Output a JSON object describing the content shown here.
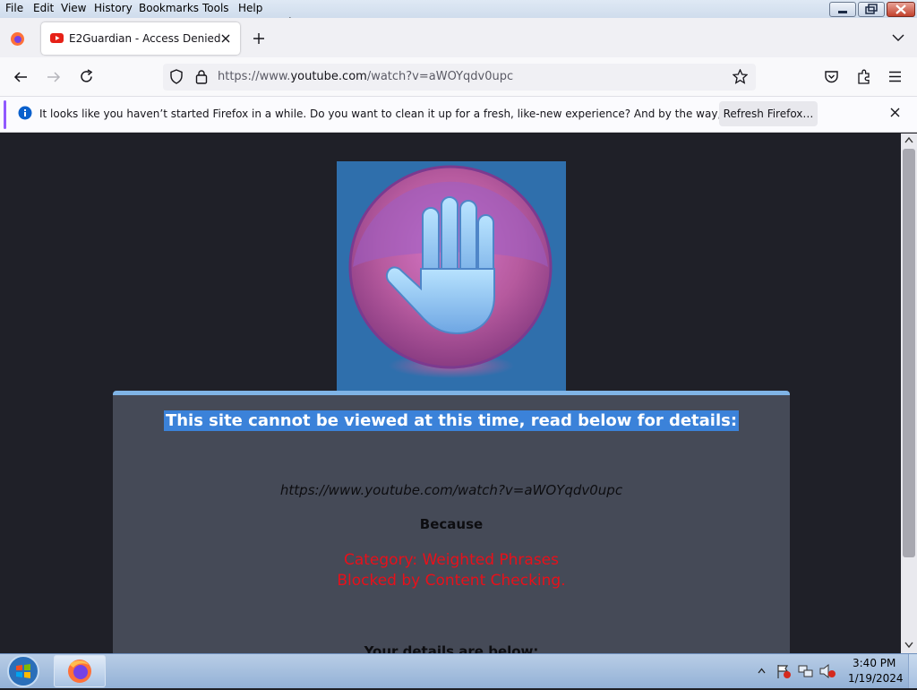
{
  "menu": {
    "file": "File",
    "edit": "Edit",
    "view": "View",
    "history": "History",
    "bookmarks": "Bookmarks",
    "tools": "Tools",
    "help": "Help"
  },
  "tab": {
    "title": "E2Guardian - Access Denied",
    "icon": "youtube-icon"
  },
  "address": {
    "prefix": "https://www.",
    "domain": "youtube.com",
    "path": "/watch?v=aWOYqdv0upc"
  },
  "notification": {
    "message": "It looks like you haven’t started Firefox in a while. Do you want to clean it up for a fresh, like-new experience? And by the way, welcome back!",
    "button": "Refresh Firefox…"
  },
  "page": {
    "headline": "This site cannot be viewed at this time, read below for details:",
    "blocked_url": "https://www.youtube.com/watch?v=aWOYqdv0upc",
    "because": "Because",
    "reason_line1": "Category: Weighted Phrases",
    "reason_line2": "Blocked by Content Checking.",
    "details": "Your details are below:"
  },
  "taskbar": {
    "time": "3:40 PM",
    "date": "1/19/2024"
  },
  "colors": {
    "accent": "#3b82d9",
    "reason": "#e8101a",
    "panel": "#454a57"
  }
}
